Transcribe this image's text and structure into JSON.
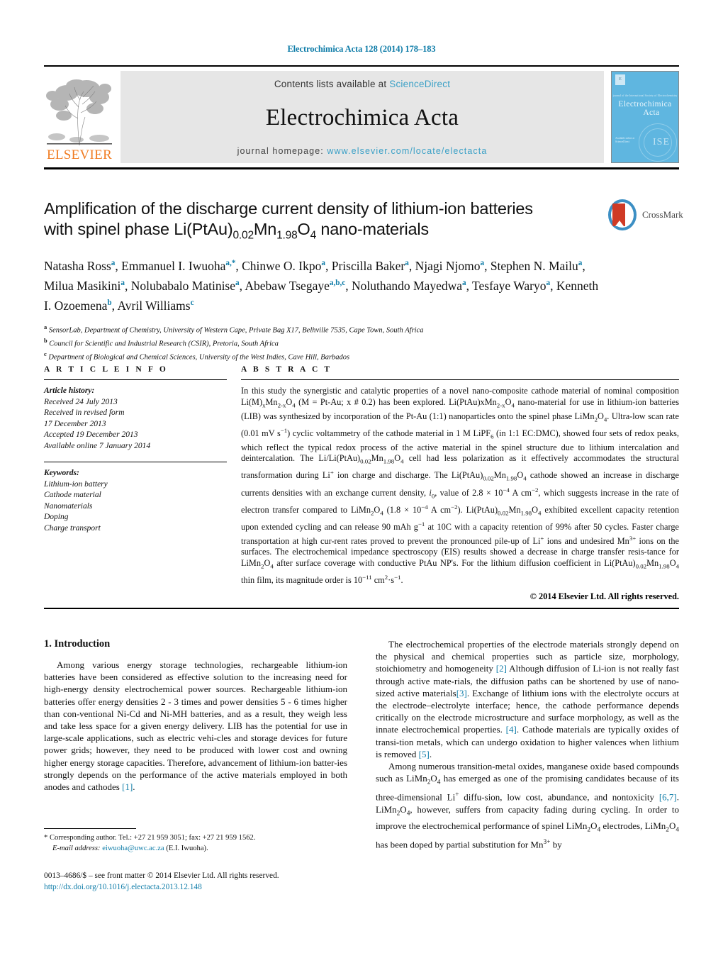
{
  "running_head": "Electrochimica Acta 128 (2014) 178–183",
  "masthead": {
    "contents_prefix": "Contents lists available at ",
    "contents_link": "ScienceDirect",
    "journal_title": "Electrochimica Acta",
    "homepage_prefix": "journal homepage: ",
    "homepage_url": "www.elsevier.com/locate/electacta",
    "publisher_logo_text": "ELSEVIER",
    "cover": {
      "title_line1": "Electrochimica",
      "title_line2": "Acta",
      "society_mark": "ISE"
    }
  },
  "title": {
    "line1_a": "Amplification of the discharge current density of lithium-ion batteries",
    "line2_a": "with spinel phase Li(PtAu)",
    "line2_sub1": "0.02",
    "line2_b": "Mn",
    "line2_sub2": "1.98",
    "line2_c": "O",
    "line2_sub3": "4",
    "line2_d": " nano-materials"
  },
  "crossmark": {
    "label": "CrossMark"
  },
  "authors": [
    {
      "name": "Natasha Ross",
      "sup": "a",
      "sep": ", "
    },
    {
      "name": "Emmanuel I. Iwuoha",
      "sup": "a,*",
      "sep": ", "
    },
    {
      "name": "Chinwe O. Ikpo",
      "sup": "a",
      "sep": ", "
    },
    {
      "name": "Priscilla Baker",
      "sup": "a",
      "sep": ", "
    },
    {
      "name": "Njagi Njomo",
      "sup": "a",
      "sep": ", "
    },
    {
      "name": "Stephen N. Mailu",
      "sup": "a",
      "sep": ", "
    },
    {
      "name": "Milua Masikini",
      "sup": "a",
      "sep": ", "
    },
    {
      "name": "Nolubabalo Matinise",
      "sup": "a",
      "sep": ", "
    },
    {
      "name": "Abebaw Tsegaye",
      "sup": "a,b,c",
      "sep": ", "
    },
    {
      "name": "Noluthando Mayedwa",
      "sup": "a",
      "sep": ", "
    },
    {
      "name": "Tesfaye Waryo",
      "sup": "a",
      "sep": ", "
    },
    {
      "name": "Kenneth I. Ozoemena",
      "sup": "b",
      "sep": ", "
    },
    {
      "name": "Avril Williams",
      "sup": "c",
      "sep": ""
    }
  ],
  "affiliations": [
    {
      "marker": "a",
      "text": "SensorLab, Department of Chemistry, University of Western Cape, Private Bag X17, Belhville 7535, Cape Town, South Africa"
    },
    {
      "marker": "b",
      "text": "Council for Scientific and Industrial Research (CSIR), Pretoria, South Africa"
    },
    {
      "marker": "c",
      "text": "Department of Biological and Chemical Sciences, University of the West Indies, Cave Hill, Barbados"
    }
  ],
  "article_info": {
    "heading": "A R T I C L E   I N F O",
    "history_label": "Article history:",
    "history": [
      "Received 24 July 2013",
      "Received in revised form",
      "17 December 2013",
      "Accepted 19 December 2013",
      "Available online 7 January 2014"
    ],
    "keywords_label": "Keywords:",
    "keywords": [
      "Lithium-ion battery",
      "Cathode material",
      "Nanomaterials",
      "Doping",
      "Charge transport"
    ]
  },
  "abstract": {
    "heading": "A B S T R A C T",
    "copyright": "© 2014 Elsevier Ltd. All rights reserved."
  },
  "intro": {
    "heading": "1.  Introduction"
  },
  "footnote": {
    "corresponding": "Corresponding author. Tel.: +27 21 959 3051; fax: +27 21 959 1562.",
    "email_label": "E-mail address:",
    "email": "eiwuoha@uwc.ac.za",
    "email_owner": "(E.I. Iwuoha)."
  },
  "colophon": {
    "issn_line": "0013–4686/$ – see front matter © 2014 Elsevier Ltd. All rights reserved.",
    "doi": "http://dx.doi.org/10.1016/j.electacta.2013.12.148"
  },
  "colors": {
    "link": "#0e7ca8",
    "sciencedirect": "#3aa0c6",
    "elsevier_orange": "#f07c22",
    "cover_blue": "#5fb6e0",
    "crossmark_blue": "#3c8fc4",
    "crossmark_red": "#cf3a25"
  }
}
